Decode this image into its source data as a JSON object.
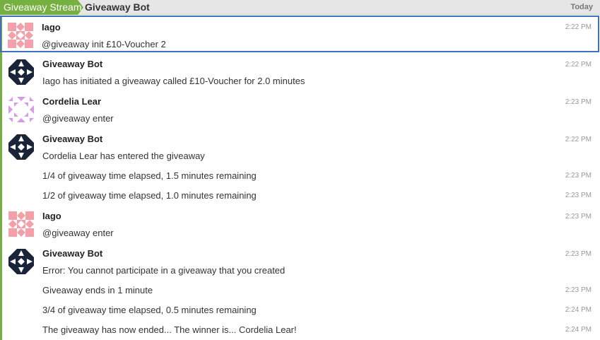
{
  "header": {
    "stream": "Giveaway Stream",
    "topic": "Giveaway Bot",
    "date": "Today"
  },
  "colors": {
    "stream": "#76b041",
    "selection": "#3e73b9",
    "avatar_iago": "#f4a0a8",
    "avatar_bot": "#1a2438",
    "avatar_cordelia": "#d89ae8"
  },
  "messages": [
    {
      "sender": "Iago",
      "avatar": "iago-avatar-icon",
      "lines": [
        {
          "text": "@giveaway init £10-Voucher 2",
          "time": "2:22 PM"
        }
      ]
    },
    {
      "sender": "Giveaway Bot",
      "avatar": "giveaway-bot-avatar-icon",
      "lines": [
        {
          "text": "Iago has initiated a giveaway called £10-Voucher for 2.0 minutes",
          "time": "2:22 PM"
        }
      ]
    },
    {
      "sender": "Cordelia Lear",
      "avatar": "cordelia-avatar-icon",
      "lines": [
        {
          "text": "@giveaway enter",
          "time": "2:23 PM"
        }
      ]
    },
    {
      "sender": "Giveaway Bot",
      "avatar": "giveaway-bot-avatar-icon",
      "lines": [
        {
          "text": "Cordelia Lear has entered the giveaway",
          "time": "2:22 PM"
        },
        {
          "text": "1/4 of giveaway time elapsed, 1.5 minutes remaining",
          "time": "2:23 PM"
        },
        {
          "text": "1/2 of giveaway time elapsed, 1.0 minutes remaining",
          "time": "2:23 PM"
        }
      ]
    },
    {
      "sender": "Iago",
      "avatar": "iago-avatar-icon",
      "lines": [
        {
          "text": "@giveaway enter",
          "time": "2:23 PM"
        }
      ]
    },
    {
      "sender": "Giveaway Bot",
      "avatar": "giveaway-bot-avatar-icon",
      "lines": [
        {
          "text": "Error: You cannot participate in a giveaway that you created",
          "time": "2:23 PM"
        },
        {
          "text": "Giveaway ends in 1 minute",
          "time": "2:23 PM"
        },
        {
          "text": "3/4 of giveaway time elapsed, 0.5 minutes remaining",
          "time": "2:24 PM"
        },
        {
          "text": "The giveaway has now ended... The winner is... Cordelia Lear!",
          "time": "2:24 PM"
        }
      ]
    }
  ]
}
